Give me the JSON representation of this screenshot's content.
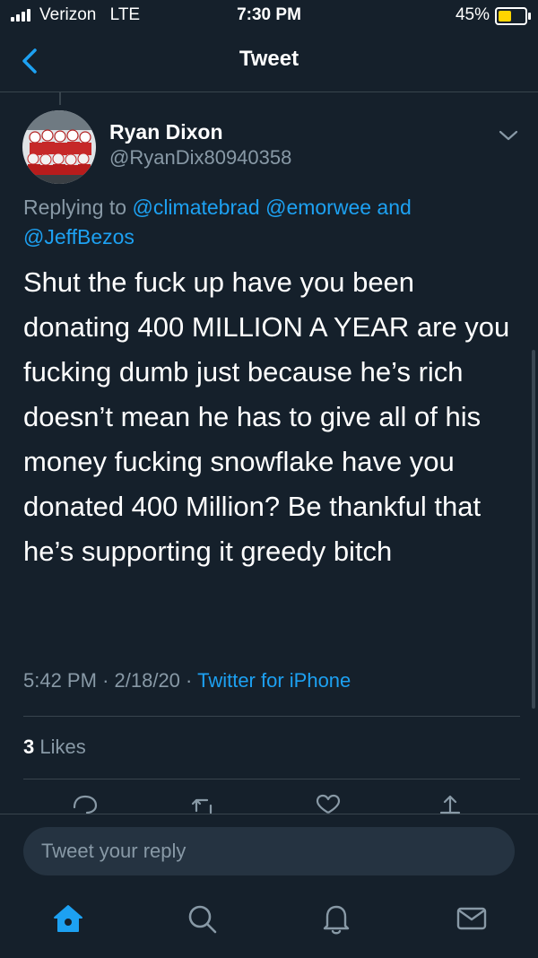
{
  "status_bar": {
    "carrier": "Verizon",
    "network": "LTE",
    "time": "7:30 PM",
    "battery": "45%",
    "battery_color": "#ffd400"
  },
  "nav": {
    "title": "Tweet",
    "back_icon": "back-chevron-icon"
  },
  "tweet": {
    "author_name": "Ryan Dixon",
    "author_handle": "@RyanDix80940358",
    "replying_prefix": "Replying to",
    "reply_to_line1": "@climatebrad @emorwee and",
    "reply_to_line2": "@JeffBezos",
    "text": "Shut the fuck up have you been donating 400 MILLION A YEAR are you fucking dumb just because he’s rich doesn’t mean he has to give all of his money fucking snowflake have you donated 400 Million? Be thankful that he’s supporting it greedy bitch",
    "time": "5:42 PM",
    "date": "2/18/20",
    "source": "Twitter for iPhone",
    "likes_count": "3",
    "likes_label": "Likes",
    "actions": [
      "reply-icon",
      "retweet-icon",
      "like-icon",
      "share-icon"
    ]
  },
  "reply_bar": {
    "placeholder": "Tweet your reply"
  },
  "tabs": [
    "home-icon",
    "search-icon",
    "notifications-icon",
    "messages-icon"
  ],
  "colors": {
    "background": "#15202b",
    "accent": "#1da1f2",
    "secondary_text": "#8899a6",
    "border": "#38444d"
  }
}
